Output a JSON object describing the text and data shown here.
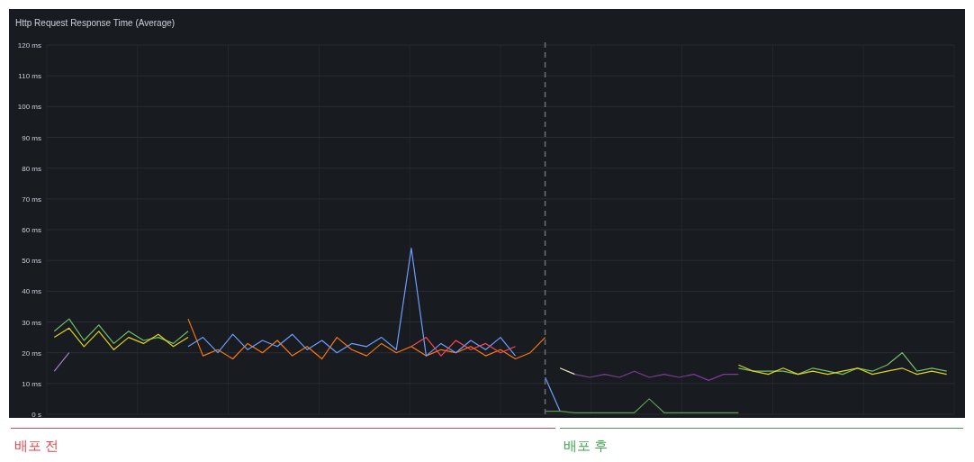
{
  "panel": {
    "chart_data": {
      "type": "line",
      "title": "Http Request Response Time (Average)",
      "grid": true,
      "ylim": [
        0,
        120
      ],
      "yticks": [
        {
          "value": 0,
          "label": "0 s"
        },
        {
          "value": 10,
          "label": "10 ms"
        },
        {
          "value": 20,
          "label": "20 ms"
        },
        {
          "value": 30,
          "label": "30 ms"
        },
        {
          "value": 40,
          "label": "40 ms"
        },
        {
          "value": 50,
          "label": "50 ms"
        },
        {
          "value": 60,
          "label": "60 ms"
        },
        {
          "value": 70,
          "label": "70 ms"
        },
        {
          "value": 80,
          "label": "80 ms"
        },
        {
          "value": 90,
          "label": "90 ms"
        },
        {
          "value": 100,
          "label": "100 ms"
        },
        {
          "value": 110,
          "label": "110 ms"
        },
        {
          "value": 120,
          "label": "120 ms"
        }
      ],
      "categories": [
        null,
        null,
        null,
        null,
        null,
        null,
        null,
        null,
        null,
        null,
        null,
        null,
        null,
        null,
        null,
        null,
        null,
        null,
        null,
        null,
        null,
        null,
        null,
        null,
        null,
        null,
        null,
        null,
        null,
        null,
        null,
        null,
        null,
        null,
        null,
        null,
        null,
        null,
        null,
        null,
        null,
        null,
        null,
        null,
        null,
        null,
        null,
        null,
        null,
        null,
        null,
        null,
        null,
        null,
        null,
        null,
        null,
        null,
        null,
        null,
        null
      ],
      "series": [
        {
          "color": "#a77fd0",
          "values": [
            14,
            20,
            null,
            null,
            null,
            null,
            null,
            null,
            null,
            null,
            null,
            null,
            null,
            null,
            null,
            null,
            null,
            null,
            null,
            null,
            null,
            null,
            null,
            null,
            null,
            null,
            null,
            null,
            null,
            null,
            null,
            null,
            null,
            null,
            null,
            null,
            null,
            null,
            null,
            null,
            null,
            null,
            null,
            null,
            null,
            null,
            null,
            null,
            null,
            null,
            null,
            null,
            null,
            null,
            null,
            null,
            null,
            null,
            null,
            null,
            null
          ]
        },
        {
          "color": "#73bf69",
          "values": [
            27,
            31,
            24,
            29,
            23,
            27,
            24,
            25,
            23,
            27,
            null,
            null,
            null,
            null,
            null,
            null,
            null,
            null,
            null,
            null,
            null,
            null,
            null,
            null,
            null,
            null,
            null,
            null,
            null,
            null,
            null,
            null,
            null,
            null,
            null,
            null,
            null,
            null,
            null,
            null,
            null,
            null,
            null,
            null,
            null,
            null,
            15,
            14,
            14,
            14,
            13,
            15,
            14,
            13,
            15,
            14,
            16,
            20,
            14,
            15,
            14
          ]
        },
        {
          "color": "#e0d21f",
          "values": [
            25,
            28,
            22,
            27,
            21,
            25,
            23,
            26,
            22,
            25,
            null,
            null,
            null,
            null,
            null,
            null,
            null,
            null,
            null,
            null,
            null,
            null,
            null,
            null,
            null,
            null,
            null,
            null,
            null,
            null,
            null,
            null,
            null,
            null,
            null,
            null,
            null,
            null,
            null,
            null,
            null,
            null,
            null,
            null,
            null,
            null,
            16,
            14,
            13,
            15,
            13,
            14,
            13,
            14,
            15,
            13,
            14,
            15,
            13,
            14,
            13
          ]
        },
        {
          "color": "#ff780a",
          "values": [
            null,
            null,
            null,
            null,
            null,
            null,
            null,
            null,
            null,
            31,
            19,
            21,
            18,
            23,
            20,
            24,
            19,
            22,
            18,
            25,
            21,
            19,
            23,
            20,
            22,
            19,
            21,
            20,
            22,
            19,
            21,
            18,
            20,
            25,
            null,
            null,
            null,
            null,
            null,
            null,
            null,
            null,
            null,
            null,
            null,
            null,
            null,
            null,
            null,
            null,
            null,
            null,
            null,
            null,
            null,
            null,
            null,
            null,
            null,
            null,
            null
          ]
        },
        {
          "color": "#6e9fff",
          "values": [
            null,
            null,
            null,
            null,
            null,
            null,
            null,
            null,
            null,
            22,
            25,
            20,
            26,
            21,
            24,
            22,
            26,
            21,
            24,
            20,
            23,
            22,
            25,
            21,
            54,
            19,
            23,
            20,
            24,
            21,
            25,
            19,
            null,
            12,
            1,
            null,
            null,
            null,
            null,
            null,
            null,
            null,
            null,
            null,
            null,
            null,
            null,
            null,
            null,
            null,
            null,
            null,
            null,
            null,
            null,
            null,
            null,
            null,
            null,
            null,
            null
          ]
        },
        {
          "color": "#f2495c",
          "values": [
            null,
            null,
            null,
            null,
            null,
            null,
            null,
            null,
            null,
            null,
            null,
            null,
            null,
            null,
            null,
            null,
            null,
            null,
            null,
            null,
            null,
            null,
            null,
            null,
            22,
            25,
            19,
            24,
            21,
            23,
            20,
            22,
            null,
            null,
            null,
            null,
            null,
            null,
            null,
            null,
            null,
            null,
            null,
            null,
            null,
            null,
            null,
            null,
            null,
            null,
            null,
            null,
            null,
            null,
            null,
            null,
            null,
            null,
            null,
            null,
            null
          ]
        },
        {
          "color": "#f4e8c1",
          "values": [
            null,
            null,
            null,
            null,
            null,
            null,
            null,
            null,
            null,
            null,
            null,
            null,
            null,
            null,
            null,
            null,
            null,
            null,
            null,
            null,
            null,
            null,
            null,
            null,
            null,
            null,
            null,
            null,
            null,
            null,
            null,
            null,
            null,
            null,
            15,
            13,
            null,
            null,
            null,
            null,
            null,
            null,
            null,
            null,
            null,
            null,
            null,
            null,
            null,
            null,
            null,
            null,
            null,
            null,
            null,
            null,
            null,
            null,
            null,
            null,
            null
          ]
        },
        {
          "color": "#7d3c98",
          "values": [
            null,
            null,
            null,
            null,
            null,
            null,
            null,
            null,
            null,
            null,
            null,
            null,
            null,
            null,
            null,
            null,
            null,
            null,
            null,
            null,
            null,
            null,
            null,
            null,
            null,
            null,
            null,
            null,
            null,
            null,
            null,
            null,
            null,
            null,
            null,
            13,
            12,
            13,
            12,
            14,
            12,
            13,
            12,
            13,
            11,
            13,
            13,
            null,
            null,
            null,
            null,
            null,
            null,
            null,
            null,
            null,
            null,
            null,
            null,
            null,
            null
          ]
        },
        {
          "color": "#5a9e4b",
          "values": [
            null,
            null,
            null,
            null,
            null,
            null,
            null,
            null,
            null,
            null,
            null,
            null,
            null,
            null,
            null,
            null,
            null,
            null,
            null,
            null,
            null,
            null,
            null,
            null,
            null,
            null,
            null,
            null,
            null,
            null,
            null,
            null,
            null,
            1,
            1,
            0.5,
            0.5,
            0.5,
            0.5,
            0.5,
            5,
            0.5,
            0.5,
            0.5,
            0.5,
            0.5,
            0.5,
            null,
            null,
            null,
            null,
            null,
            null,
            null,
            null,
            null,
            null,
            null,
            null,
            null,
            null
          ]
        }
      ]
    }
  },
  "phases": [
    {
      "label": "배포 전",
      "color": "#e0474c"
    },
    {
      "label": "배포 후",
      "color": "#3fa34d"
    }
  ]
}
